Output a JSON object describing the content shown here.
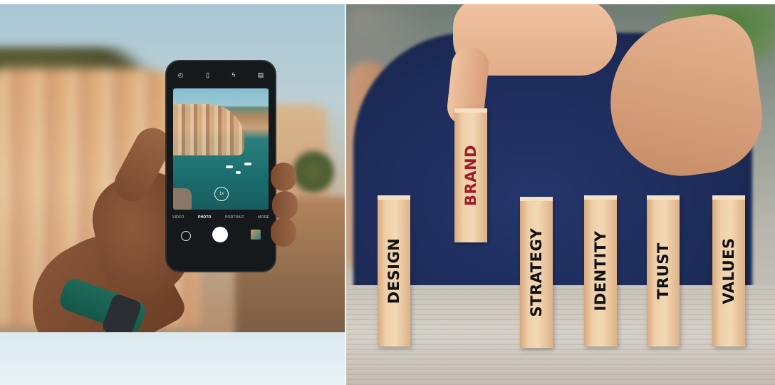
{
  "right_photo": {
    "blocks": [
      {
        "label": "DESIGN",
        "color": "#111111"
      },
      {
        "label": "BRAND",
        "color": "#a01e22"
      },
      {
        "label": "STRATEGY",
        "color": "#111111"
      },
      {
        "label": "IDENTITY",
        "color": "#111111"
      },
      {
        "label": "TRUST",
        "color": "#111111"
      },
      {
        "label": "VALUES",
        "color": "#111111"
      }
    ]
  },
  "left_photo": {
    "phone_ui": {
      "top_icons": [
        "timer-icon",
        "ratio-icon",
        "flash-icon",
        "hdr-icon"
      ],
      "zoom": "1x",
      "modes": [
        "VIDEO",
        "PHOTO",
        "PORTRAIT",
        "MORE"
      ],
      "active_mode": "PHOTO"
    }
  }
}
